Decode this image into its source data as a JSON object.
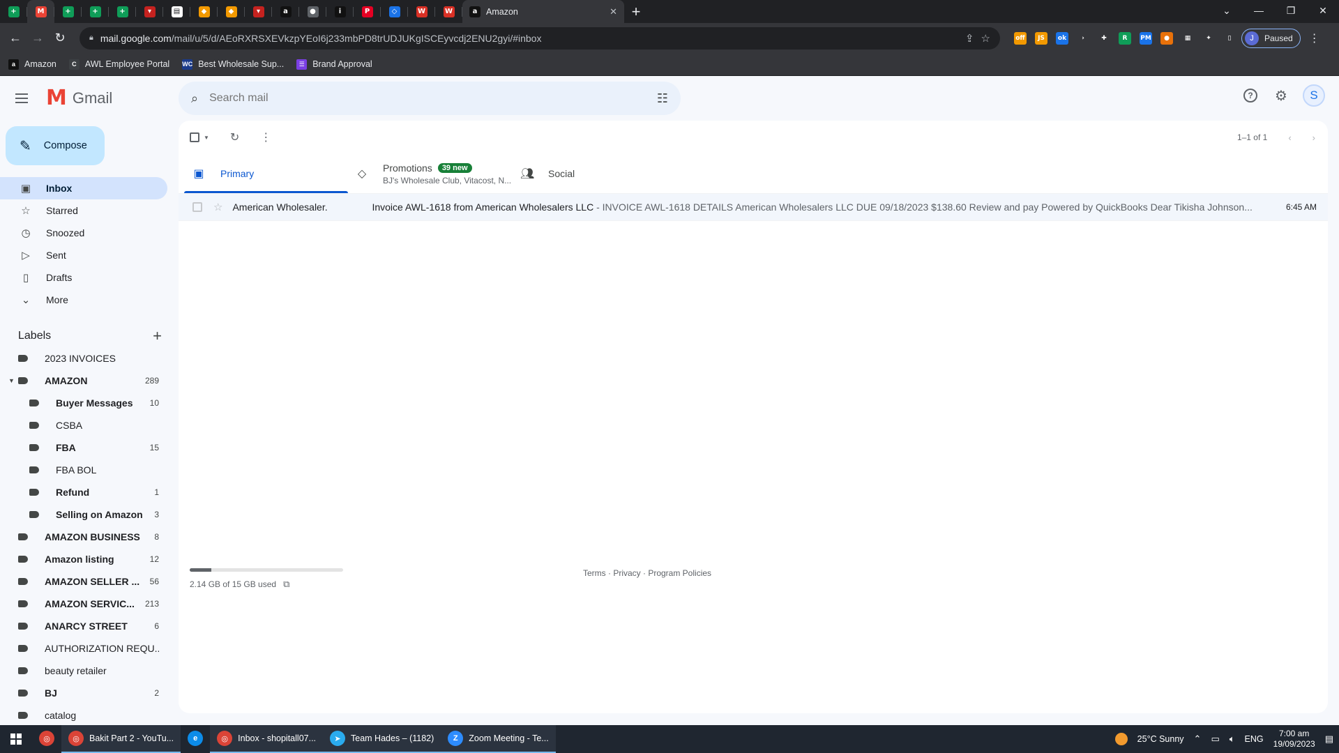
{
  "browser": {
    "mini_tabs": [
      {
        "icon": "sheets-icon",
        "color": "#0f9d58",
        "glyph": "+"
      },
      {
        "icon": "gmail-icon",
        "color": "#ea4335",
        "glyph": "M",
        "active": true
      },
      {
        "icon": "sheets-icon",
        "color": "#0f9d58",
        "glyph": "+"
      },
      {
        "icon": "sheets-icon",
        "color": "#0f9d58",
        "glyph": "+"
      },
      {
        "icon": "sheets-icon",
        "color": "#0f9d58",
        "glyph": "+"
      },
      {
        "icon": "red-tag-icon",
        "color": "#c5221f",
        "glyph": "▾"
      },
      {
        "icon": "whiteboard-icon",
        "color": "#ffffff",
        "glyph": "▤"
      },
      {
        "icon": "orange-doc-icon",
        "color": "#f29900",
        "glyph": "◆"
      },
      {
        "icon": "orange-doc-icon",
        "color": "#f29900",
        "glyph": "◆"
      },
      {
        "icon": "red-tag-icon",
        "color": "#c5221f",
        "glyph": "▾"
      },
      {
        "icon": "amazon-icon",
        "color": "#111111",
        "glyph": "a"
      },
      {
        "icon": "grey-circle-icon",
        "color": "#5f6368",
        "glyph": "●"
      },
      {
        "icon": "italic-i-icon",
        "color": "#111111",
        "glyph": "i"
      },
      {
        "icon": "pinterest-icon",
        "color": "#e60023",
        "glyph": "P"
      },
      {
        "icon": "diamond-icon",
        "color": "#1a73e8",
        "glyph": "◇"
      },
      {
        "icon": "ww-icon",
        "color": "#d93025",
        "glyph": "W"
      },
      {
        "icon": "ww-icon",
        "color": "#d93025",
        "glyph": "W"
      }
    ],
    "active_tab": {
      "title": "Amazon",
      "icon": "amazon-icon"
    },
    "url_host": "mail.google.com",
    "url_path": "/mail/u/5/d/AEoRXRSXEVkzpYEoI6j233mbPD8trUDJUKgISCEyvcdj2ENU2gyi/#inbox",
    "profile_initial": "J",
    "profile_status": "Paused",
    "extensions": [
      {
        "name": "off-ext-icon",
        "color": "#f29900",
        "glyph": "off"
      },
      {
        "name": "js-ext-icon",
        "color": "#f29900",
        "glyph": "JS"
      },
      {
        "name": "ok-ext-icon",
        "color": "#1a73e8",
        "glyph": "ok"
      },
      {
        "name": "arrow-ext-icon",
        "color": "#35363a",
        "glyph": "›"
      },
      {
        "name": "plus-ext-icon",
        "color": "#35363a",
        "glyph": "✚"
      },
      {
        "name": "r-ext-icon",
        "color": "#0f9d58",
        "glyph": "R"
      },
      {
        "name": "pm-ext-icon",
        "color": "#1a73e8",
        "glyph": "PM"
      },
      {
        "name": "orange-ext-icon",
        "color": "#e8710a",
        "glyph": "●"
      },
      {
        "name": "grid-ext-icon",
        "color": "#35363a",
        "glyph": "▦"
      },
      {
        "name": "puzzle-ext-icon",
        "color": "#35363a",
        "glyph": "✦"
      },
      {
        "name": "sidepanel-icon",
        "color": "#35363a",
        "glyph": "▯"
      }
    ]
  },
  "bookmarks": [
    {
      "label": "Amazon",
      "icon": "amazon-icon",
      "color": "#111111",
      "glyph": "a"
    },
    {
      "label": "AWL Employee Portal",
      "icon": "awl-icon",
      "color": "#3c4043",
      "glyph": "C"
    },
    {
      "label": "Best Wholesale Sup...",
      "icon": "wc-icon",
      "color": "#1a3a8a",
      "glyph": "WC"
    },
    {
      "label": "Brand Approval",
      "icon": "list-icon",
      "color": "#7b3fe4",
      "glyph": "☰"
    }
  ],
  "gmail": {
    "logo_text": "Gmail",
    "search_placeholder": "Search mail",
    "avatar_initial": "S"
  },
  "sidebar": {
    "compose_label": "Compose",
    "nav": [
      {
        "label": "Inbox",
        "icon": "inbox-icon",
        "glyph": "▣",
        "active": true
      },
      {
        "label": "Starred",
        "icon": "star-icon",
        "glyph": "☆"
      },
      {
        "label": "Snoozed",
        "icon": "clock-icon",
        "glyph": "◷"
      },
      {
        "label": "Sent",
        "icon": "send-icon",
        "glyph": "▷"
      },
      {
        "label": "Drafts",
        "icon": "draft-icon",
        "glyph": "▯"
      },
      {
        "label": "More",
        "icon": "chevron-down-icon",
        "glyph": "⌄"
      }
    ],
    "labels_title": "Labels",
    "labels": [
      {
        "name": "2023 INVOICES",
        "count": "",
        "bold": false,
        "level": 0,
        "caret": false
      },
      {
        "name": "AMAZON",
        "count": "289",
        "bold": true,
        "level": 0,
        "caret": true
      },
      {
        "name": "Buyer Messages",
        "count": "10",
        "bold": true,
        "level": 1,
        "caret": false
      },
      {
        "name": "CSBA",
        "count": "",
        "bold": false,
        "level": 1,
        "caret": false
      },
      {
        "name": "FBA",
        "count": "15",
        "bold": true,
        "level": 1,
        "caret": false
      },
      {
        "name": "FBA BOL",
        "count": "",
        "bold": false,
        "level": 1,
        "caret": false
      },
      {
        "name": "Refund",
        "count": "1",
        "bold": true,
        "level": 1,
        "caret": false
      },
      {
        "name": "Selling on Amazon",
        "count": "3",
        "bold": true,
        "level": 1,
        "caret": false
      },
      {
        "name": "AMAZON BUSINESS",
        "count": "8",
        "bold": true,
        "level": 0,
        "caret": false
      },
      {
        "name": "Amazon listing",
        "count": "12",
        "bold": true,
        "level": 0,
        "caret": false
      },
      {
        "name": "AMAZON SELLER ...",
        "count": "56",
        "bold": true,
        "level": 0,
        "caret": false
      },
      {
        "name": "AMAZON SERVIC...",
        "count": "213",
        "bold": true,
        "level": 0,
        "caret": false
      },
      {
        "name": "ANARCY STREET",
        "count": "6",
        "bold": true,
        "level": 0,
        "caret": false
      },
      {
        "name": "AUTHORIZATION REQU...",
        "count": "",
        "bold": false,
        "level": 0,
        "caret": false
      },
      {
        "name": "beauty retailer",
        "count": "",
        "bold": false,
        "level": 0,
        "caret": false
      },
      {
        "name": "BJ",
        "count": "2",
        "bold": true,
        "level": 0,
        "caret": false
      },
      {
        "name": "catalog",
        "count": "",
        "bold": false,
        "level": 0,
        "caret": false
      }
    ]
  },
  "main": {
    "pager": "1–1 of 1",
    "tabs": {
      "primary": "Primary",
      "promotions": "Promotions",
      "promotions_badge": "39 new",
      "promotions_sub": "BJ's Wholesale Club, Vitacost, N...",
      "social": "Social"
    },
    "emails": [
      {
        "sender": "American Wholesaler.",
        "subject": "Invoice AWL-1618 from American Wholesalers LLC",
        "snippet": " - INVOICE AWL-1618 DETAILS American Wholesalers LLC DUE 09/18/2023 $138.60 Review and pay Powered by QuickBooks Dear Tikisha Johnson...",
        "time": "6:45 AM"
      }
    ],
    "storage_text": "2.14 GB of 15 GB used",
    "storage_fraction": 0.143,
    "policies": "Terms · Privacy · Program Policies"
  },
  "taskbar": {
    "apps": [
      {
        "label": "",
        "icon": "chrome-icon",
        "color": "#db4437",
        "glyph": "◎",
        "open": false
      },
      {
        "label": "Bakit Part 2 - YouTu...",
        "icon": "chrome-icon",
        "color": "#db4437",
        "glyph": "◎",
        "open": true
      },
      {
        "label": "",
        "icon": "edge-icon",
        "color": "#0c8ce9",
        "glyph": "e",
        "open": false
      },
      {
        "label": "Inbox - shopitall07...",
        "icon": "chrome-icon",
        "color": "#db4437",
        "glyph": "◎",
        "open": true
      },
      {
        "label": "Team Hades – (1182)",
        "icon": "telegram-icon",
        "color": "#2aabee",
        "glyph": "➤",
        "open": true
      },
      {
        "label": "Zoom Meeting - Te...",
        "icon": "zoom-icon",
        "color": "#2d8cff",
        "glyph": "Z",
        "open": true
      }
    ],
    "weather": "25°C  Sunny",
    "lang": "ENG",
    "time": "7:00 am",
    "date": "19/09/2023"
  }
}
